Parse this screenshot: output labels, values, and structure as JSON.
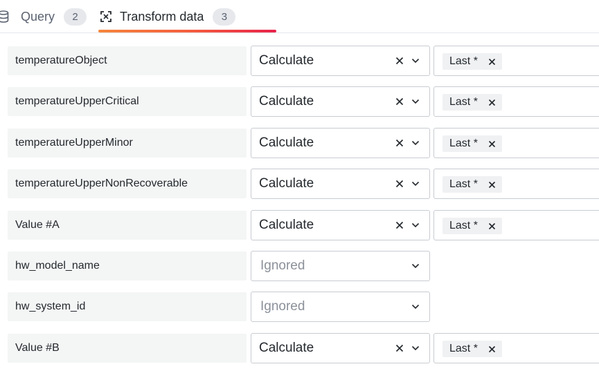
{
  "tabs": [
    {
      "label": "Query",
      "count": "2",
      "icon": "database-icon"
    },
    {
      "label": "Transform data",
      "count": "3",
      "icon": "transform-icon",
      "active": true
    }
  ],
  "accent_gradient": [
    "#f5863c",
    "#e8234a"
  ],
  "rows": [
    {
      "field": "temperatureObject",
      "mode": "Calculate",
      "calc": "Last *"
    },
    {
      "field": "temperatureUpperCritical",
      "mode": "Calculate",
      "calc": "Last *"
    },
    {
      "field": "temperatureUpperMinor",
      "mode": "Calculate",
      "calc": "Last *"
    },
    {
      "field": "temperatureUpperNonRecoverable",
      "mode": "Calculate",
      "calc": "Last *"
    },
    {
      "field": "Value #A",
      "mode": "Calculate",
      "calc": "Last *"
    },
    {
      "field": "hw_model_name",
      "mode": "Ignored"
    },
    {
      "field": "hw_system_id",
      "mode": "Ignored"
    },
    {
      "field": "Value #B",
      "mode": "Calculate",
      "calc": "Last *"
    }
  ]
}
